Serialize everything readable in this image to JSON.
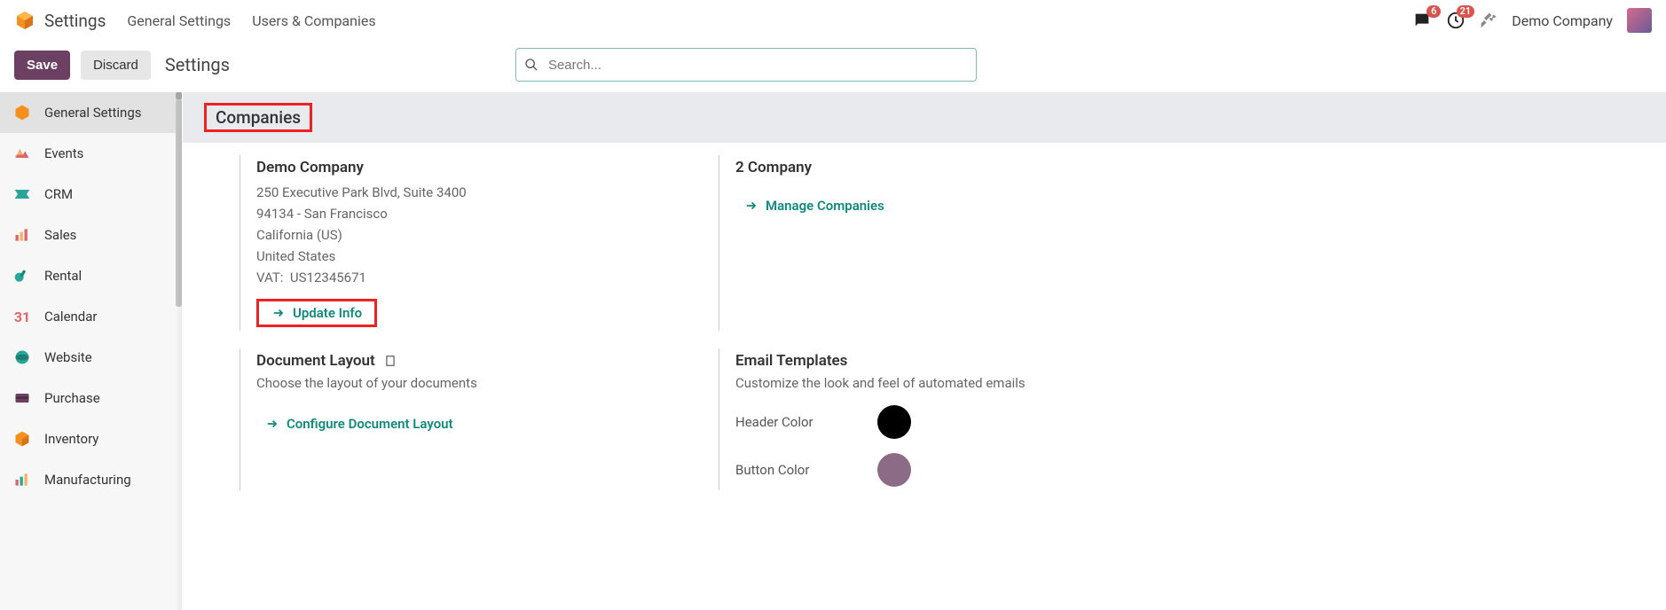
{
  "header": {
    "app_title": "Settings",
    "links": [
      "General Settings",
      "Users & Companies"
    ],
    "company_label": "Demo Company",
    "messages_badge": "6",
    "activities_badge": "21"
  },
  "toolbar": {
    "save_label": "Save",
    "discard_label": "Discard",
    "title": "Settings",
    "search_placeholder": "Search..."
  },
  "sidebar": {
    "items": [
      {
        "label": "General Settings",
        "icon": "hex-orange",
        "active": true
      },
      {
        "label": "Events",
        "icon": "events"
      },
      {
        "label": "CRM",
        "icon": "crm"
      },
      {
        "label": "Sales",
        "icon": "sales"
      },
      {
        "label": "Rental",
        "icon": "rental"
      },
      {
        "label": "Calendar",
        "icon": "calendar"
      },
      {
        "label": "Website",
        "icon": "website"
      },
      {
        "label": "Purchase",
        "icon": "purchase"
      },
      {
        "label": "Inventory",
        "icon": "inventory"
      },
      {
        "label": "Manufacturing",
        "icon": "manufacturing"
      }
    ]
  },
  "section": {
    "title": "Companies"
  },
  "company": {
    "name": "Demo Company",
    "addr1": "250 Executive Park Blvd, Suite 3400",
    "addr2": "94134 - San Francisco",
    "addr3": "California (US)",
    "addr4": "United States",
    "vat_label": "VAT:",
    "vat_value": "US12345671",
    "update_label": "Update Info"
  },
  "companies_count": {
    "label": "2 Company",
    "manage_label": "Manage Companies"
  },
  "doc_layout": {
    "title": "Document Layout",
    "sub": "Choose the layout of your documents",
    "action": "Configure Document Layout"
  },
  "email_tpl": {
    "title": "Email Templates",
    "sub": "Customize the look and feel of automated emails",
    "header_color_label": "Header Color",
    "button_color_label": "Button Color",
    "header_color": "#000000",
    "button_color": "#8b6b86"
  }
}
